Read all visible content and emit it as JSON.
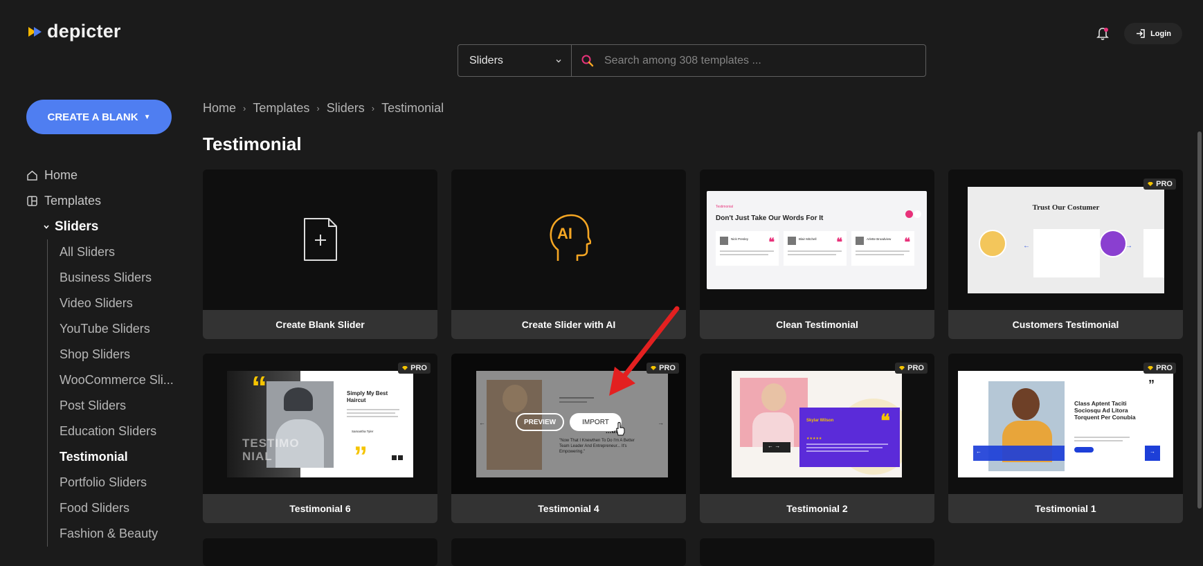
{
  "app": {
    "brand": "depicter"
  },
  "header": {
    "login_label": "Login"
  },
  "search": {
    "category": "Sliders",
    "placeholder": "Search among 308 templates ..."
  },
  "sidebar": {
    "create_label": "CREATE A BLANK",
    "home_label": "Home",
    "templates_label": "Templates",
    "sliders_label": "Sliders",
    "items": [
      {
        "label": "All Sliders"
      },
      {
        "label": "Business Sliders"
      },
      {
        "label": "Video Sliders"
      },
      {
        "label": "YouTube Sliders"
      },
      {
        "label": "Shop Sliders"
      },
      {
        "label": "WooCommerce Sli..."
      },
      {
        "label": "Post Sliders"
      },
      {
        "label": "Education Sliders"
      },
      {
        "label": "Testimonial",
        "active": true
      },
      {
        "label": "Portfolio Sliders"
      },
      {
        "label": "Food Sliders"
      },
      {
        "label": "Fashion & Beauty"
      }
    ]
  },
  "breadcrumb": [
    "Home",
    "Templates",
    "Sliders",
    "Testimonial"
  ],
  "page": {
    "title": "Testimonial"
  },
  "cards": [
    {
      "label": "Create Blank Slider",
      "pro": false
    },
    {
      "label": "Create Slider with AI",
      "pro": false
    },
    {
      "label": "Clean Testimonial",
      "pro": false
    },
    {
      "label": "Customers Testimonial",
      "pro": true
    },
    {
      "label": "Testimonial 6",
      "pro": true
    },
    {
      "label": "Testimonial 4",
      "pro": true
    },
    {
      "label": "Testimonial 2",
      "pro": true
    },
    {
      "label": "Testimonial 1",
      "pro": true
    }
  ],
  "pro_badge": "PRO",
  "hover": {
    "preview_label": "PREVIEW",
    "import_label": "IMPORT"
  },
  "thumbs": {
    "ai_text": "AI",
    "clean": {
      "eyebrow": "Testimonial",
      "heading": "Don't Just Take Our Words For It",
      "names": [
        "Nick Presley",
        "Blair Mitchell",
        "Arlette Broadview"
      ]
    },
    "customers": {
      "heading": "Trust Our Costumer"
    },
    "t6": {
      "heading": "Simply My Best Haircut",
      "big_text": "TESTIMO NIAL",
      "author": "Samantha Tyler"
    },
    "t4": {
      "quote": "\"Now That I Knewthen To Do I'm A Better Team Leader And Entrepreneur... It's Empowering.\"",
      "partial": "...tiful"
    },
    "t2": {
      "name": "Skylar Wilson"
    },
    "t1": {
      "heading": "Class Aptent Taciti Sociosqu Ad Litora Torquent Per Conubia"
    }
  },
  "colors": {
    "accent": "#4f7ef1",
    "bg": "#1b1b1b",
    "card_label_bg": "#333333",
    "ai_orange": "#f5a623",
    "pink": "#e8327a",
    "purple": "#5b2bd9",
    "blue": "#1d3fd8"
  }
}
